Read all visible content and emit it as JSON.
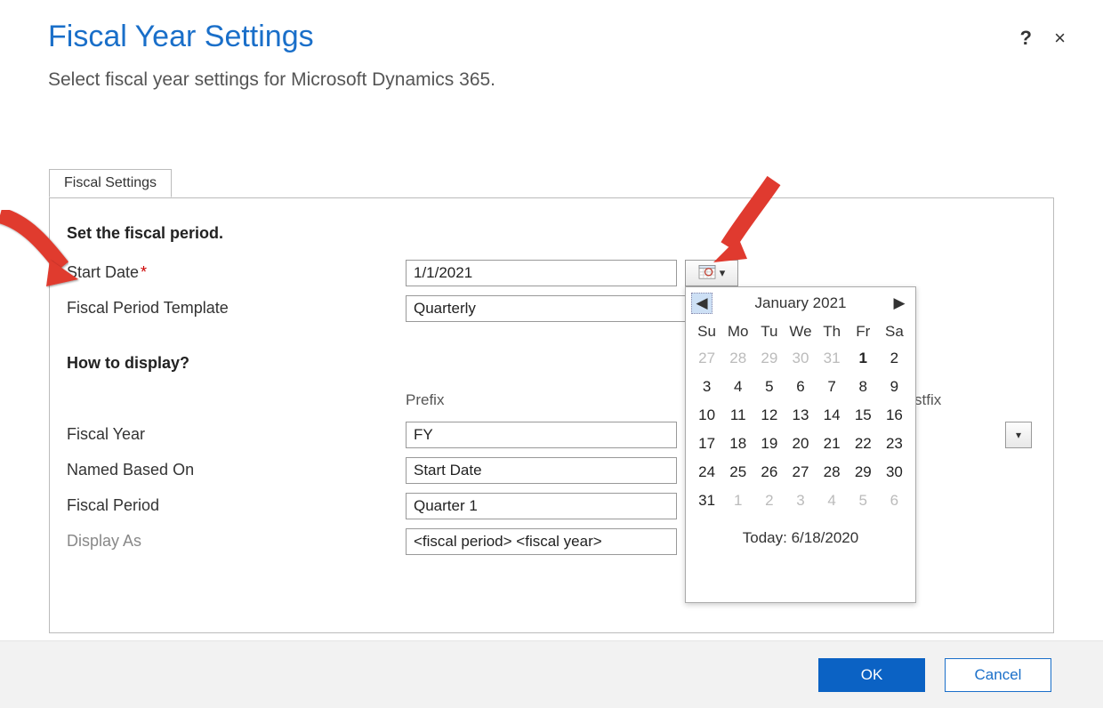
{
  "header": {
    "title": "Fiscal Year Settings",
    "subtitle": "Select fiscal year settings for Microsoft Dynamics 365.",
    "help": "?",
    "close": "×"
  },
  "tab": {
    "label": "Fiscal Settings"
  },
  "section": {
    "set_period": "Set the fiscal period.",
    "how_display": "How to display?"
  },
  "labels": {
    "start_date": "Start Date",
    "template": "Fiscal Period Template",
    "prefix": "Prefix",
    "postfix": "stfix",
    "fiscal_year": "Fiscal Year",
    "named_based_on": "Named Based On",
    "fiscal_period": "Fiscal Period",
    "display_as": "Display As"
  },
  "values": {
    "start_date": "1/1/2021",
    "template": "Quarterly",
    "prefix": "FY",
    "named_based_on": "Start Date",
    "fiscal_period": "Quarter 1",
    "display_as": "<fiscal period> <fiscal year>"
  },
  "calendar": {
    "title": "January 2021",
    "prev": "◀",
    "next": "▶",
    "weekdays": [
      "Su",
      "Mo",
      "Tu",
      "We",
      "Th",
      "Fr",
      "Sa"
    ],
    "weeks": [
      [
        {
          "n": 27,
          "out": true
        },
        {
          "n": 28,
          "out": true
        },
        {
          "n": 29,
          "out": true
        },
        {
          "n": 30,
          "out": true
        },
        {
          "n": 31,
          "out": true
        },
        {
          "n": 1,
          "sel": true
        },
        {
          "n": 2
        }
      ],
      [
        {
          "n": 3
        },
        {
          "n": 4
        },
        {
          "n": 5
        },
        {
          "n": 6
        },
        {
          "n": 7
        },
        {
          "n": 8
        },
        {
          "n": 9
        }
      ],
      [
        {
          "n": 10
        },
        {
          "n": 11
        },
        {
          "n": 12
        },
        {
          "n": 13
        },
        {
          "n": 14
        },
        {
          "n": 15
        },
        {
          "n": 16
        }
      ],
      [
        {
          "n": 17
        },
        {
          "n": 18
        },
        {
          "n": 19
        },
        {
          "n": 20
        },
        {
          "n": 21
        },
        {
          "n": 22
        },
        {
          "n": 23
        }
      ],
      [
        {
          "n": 24
        },
        {
          "n": 25
        },
        {
          "n": 26
        },
        {
          "n": 27
        },
        {
          "n": 28
        },
        {
          "n": 29
        },
        {
          "n": 30
        }
      ],
      [
        {
          "n": 31
        },
        {
          "n": 1,
          "out": true
        },
        {
          "n": 2,
          "out": true
        },
        {
          "n": 3,
          "out": true
        },
        {
          "n": 4,
          "out": true
        },
        {
          "n": 5,
          "out": true
        },
        {
          "n": 6,
          "out": true
        }
      ]
    ],
    "today_label": "Today: 6/18/2020"
  },
  "buttons": {
    "ok": "OK",
    "cancel": "Cancel"
  },
  "annotations": {
    "arrows": [
      "points to Start Date label",
      "points to date-picker button"
    ]
  }
}
